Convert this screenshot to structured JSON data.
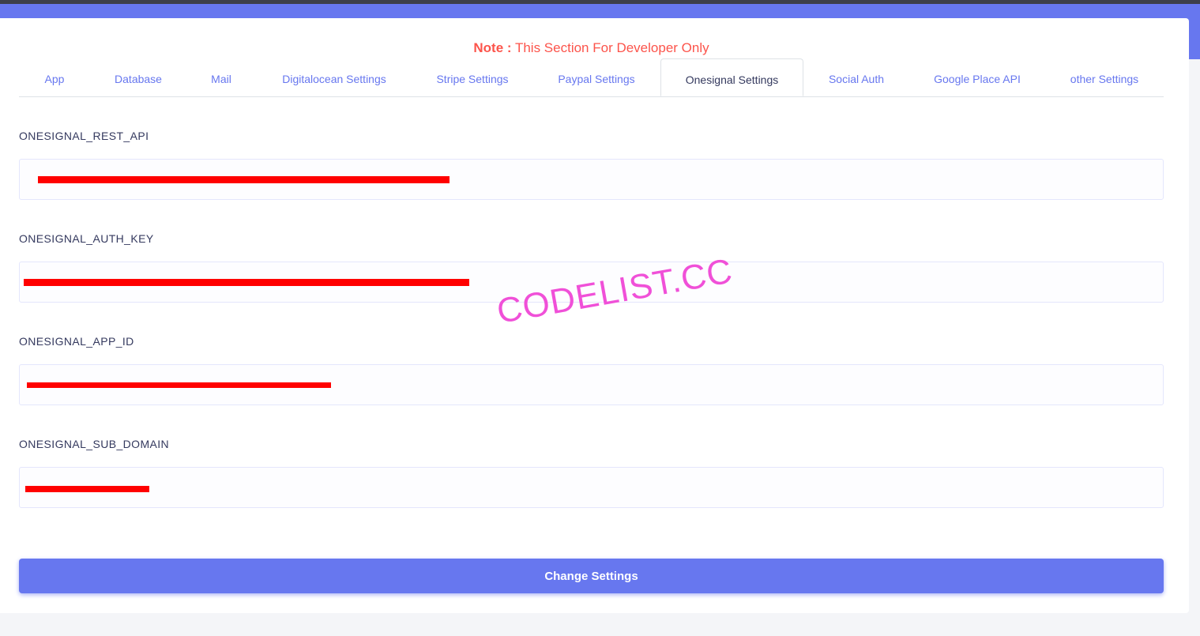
{
  "note": {
    "prefix": "Note :",
    "text": " This Section For Developer Only"
  },
  "tabs": [
    {
      "label": "App"
    },
    {
      "label": "Database"
    },
    {
      "label": "Mail"
    },
    {
      "label": "Digitalocean Settings"
    },
    {
      "label": "Stripe Settings"
    },
    {
      "label": "Paypal Settings"
    },
    {
      "label": "Onesignal Settings"
    },
    {
      "label": "Social Auth"
    },
    {
      "label": "Google Place API"
    },
    {
      "label": "other Settings"
    }
  ],
  "active_tab": "Onesignal Settings",
  "fields": [
    {
      "label": "ONESIGNAL_REST_API",
      "value": ""
    },
    {
      "label": "ONESIGNAL_AUTH_KEY",
      "value": ""
    },
    {
      "label": "ONESIGNAL_APP_ID",
      "value": ""
    },
    {
      "label": "ONESIGNAL_SUB_DOMAIN",
      "value": ""
    }
  ],
  "submit_label": "Change Settings",
  "watermark": "CODELIST.CC",
  "colors": {
    "primary": "#6777ef",
    "note_red": "#fc544b",
    "redaction": "#ff0000",
    "watermark": "#f050d8"
  }
}
